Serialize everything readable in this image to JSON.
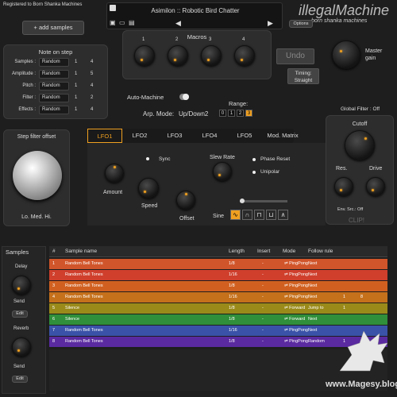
{
  "registered": "Registered to Born Shanka Machines",
  "add_samples": "+ add samples",
  "note_on_step": {
    "title": "Note on step",
    "rows": [
      {
        "label": "Samples :",
        "value": "Random",
        "a": "1",
        "b": "4"
      },
      {
        "label": "Amplitude :",
        "value": "Random",
        "a": "1",
        "b": "5"
      },
      {
        "label": "Pitch :",
        "value": "Random",
        "a": "1",
        "b": "4"
      },
      {
        "label": "Filter :",
        "value": "Random",
        "a": "1",
        "b": "2"
      },
      {
        "label": "Effects :",
        "value": "Random",
        "a": "1",
        "b": "4"
      }
    ]
  },
  "preset_name": "Asimilon :: Robotic Bird Chatter",
  "logo": "illegalMachine",
  "logo_sub": "born shanka machines",
  "options": "Options",
  "macros": {
    "title": "Macros",
    "nums": [
      "1",
      "2",
      "3",
      "4"
    ]
  },
  "undo": "Undo",
  "master_gain": "Master gain",
  "timing_label": "Timing:",
  "timing_value": "Straight",
  "auto_machine": "Auto-Machine",
  "range_label": "Range:",
  "arp_mode_label": "Arp. Mode:",
  "arp_mode_value": "Up/Down2",
  "range_values": [
    "0",
    "1",
    "2",
    "3"
  ],
  "step_filter_offset": "Step filter offset",
  "lo_med_hi": "Lo. Med. Hi.",
  "global_filter": "Global Filter : Off",
  "cutoff": "Cutoff",
  "res": "Res.",
  "drive": "Drive",
  "env_src": "Env. Src.: Off",
  "clip": "CLIP!",
  "lfo_tabs": [
    "LFO1",
    "LFO2",
    "LFO3",
    "LFO4",
    "LFO5",
    "Mod. Matrix"
  ],
  "sync": "Sync",
  "slew_rate": "Slew Rate",
  "phase_reset": "Phase Reset",
  "unipolar": "Unipolar",
  "amount": "Amount",
  "speed": "Speed",
  "offset": "Offset",
  "sine": "Sine",
  "samples_section": "Samples",
  "delay": "Delay",
  "reverb": "Reverb",
  "send": "Send",
  "edit": "Edit",
  "table_headers": [
    "#",
    "Sample name",
    "Length",
    "Insert",
    "Mode",
    "Follow rule"
  ],
  "rows": [
    {
      "n": "1",
      "name": "Random Bell Tones",
      "len": "1/8",
      "ins": "-",
      "mode": "PingPong",
      "rule": "Next",
      "x": "",
      "y": "",
      "color": "#d1552a"
    },
    {
      "n": "2",
      "name": "Random Bell Tones",
      "len": "1/16",
      "ins": "-",
      "mode": "PingPong",
      "rule": "Next",
      "x": "",
      "y": "",
      "color": "#cf3f2c"
    },
    {
      "n": "3",
      "name": "Random Bell Tones",
      "len": "1/8",
      "ins": "-",
      "mode": "PingPong",
      "rule": "Next",
      "x": "",
      "y": "",
      "color": "#d16020"
    },
    {
      "n": "4",
      "name": "Random Bell Tones",
      "len": "1/16",
      "ins": "-",
      "mode": "PingPong",
      "rule": "Next",
      "x": "1",
      "y": "8",
      "color": "#c5701b"
    },
    {
      "n": "5",
      "name": "Silence",
      "len": "1/8",
      "ins": "-",
      "mode": "Forward",
      "rule": "Jump to",
      "x": "1",
      "y": "",
      "color": "#9a8a1a"
    },
    {
      "n": "6",
      "name": "Silence",
      "len": "1/8",
      "ins": "-",
      "mode": "Forward",
      "rule": "Next",
      "x": "",
      "y": "",
      "color": "#2f8f3a"
    },
    {
      "n": "7",
      "name": "Random Bell Tones",
      "len": "1/16",
      "ins": "-",
      "mode": "PingPong",
      "rule": "Next",
      "x": "",
      "y": "",
      "color": "#3a52a8"
    },
    {
      "n": "8",
      "name": "Random Bell Tones",
      "len": "1/8",
      "ins": "-",
      "mode": "PingPong",
      "rule": "Random",
      "x": "1",
      "y": "",
      "color": "#5a2aa0"
    }
  ],
  "watermark": "www.Magesy.blog"
}
